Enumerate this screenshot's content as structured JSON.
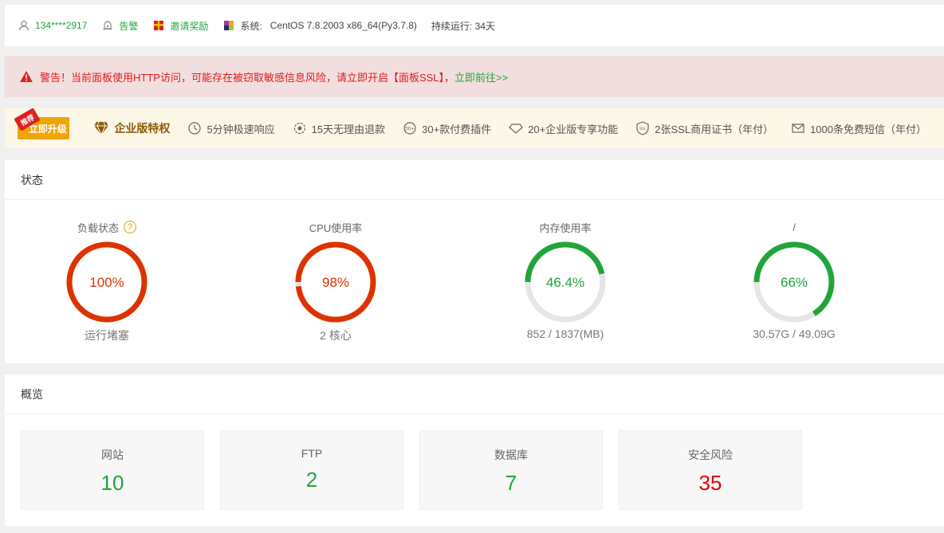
{
  "topbar": {
    "user": "134****2917",
    "alarm": "告警",
    "invite": "邀请奖励",
    "system_label": "系统:",
    "system_value": "CentOS 7.8.2003 x86_64(Py3.7.8)",
    "uptime": "持续运行: 34天"
  },
  "alert": {
    "text": "警告！当前面板使用HTTP访问，可能存在被窃取敏感信息风险，请立即开启【面板SSL】，",
    "link": "立即前往>>"
  },
  "promo": {
    "button": "立即升级",
    "ribbon": "推荐",
    "enterprise": "企业版特权",
    "features": [
      {
        "icon": "clock-icon",
        "text": "5分钟极速响应"
      },
      {
        "icon": "refund-icon",
        "text": "15天无理由退款"
      },
      {
        "icon": "plugin-icon",
        "text": "30+款付费插件"
      },
      {
        "icon": "diamond-icon",
        "text": "20+企业版专享功能"
      },
      {
        "icon": "ssl-icon",
        "text": "2张SSL商用证书（年付）"
      },
      {
        "icon": "mail-icon",
        "text": "1000条免费短信（年付）"
      }
    ]
  },
  "status": {
    "title": "状态",
    "gauges": [
      {
        "title": "负载状态",
        "value": "100%",
        "percent": 100,
        "sub": "运行堵塞",
        "color": "#dd3300",
        "help": "?"
      },
      {
        "title": "CPU使用率",
        "value": "98%",
        "percent": 98,
        "sub": "2 核心",
        "color": "#dd3300"
      },
      {
        "title": "内存使用率",
        "value": "46.4%",
        "percent": 46.4,
        "sub": "852 / 1837(MB)",
        "color": "#20a53a"
      },
      {
        "title": "/",
        "value": "66%",
        "percent": 66,
        "sub": "30.57G / 49.09G",
        "color": "#20a53a"
      }
    ]
  },
  "overview": {
    "title": "概览",
    "cards": [
      {
        "label": "网站",
        "value": "10"
      },
      {
        "label": "FTP",
        "value": "2"
      },
      {
        "label": "数据库",
        "value": "7"
      },
      {
        "label": "安全风险",
        "value": "35"
      }
    ]
  }
}
